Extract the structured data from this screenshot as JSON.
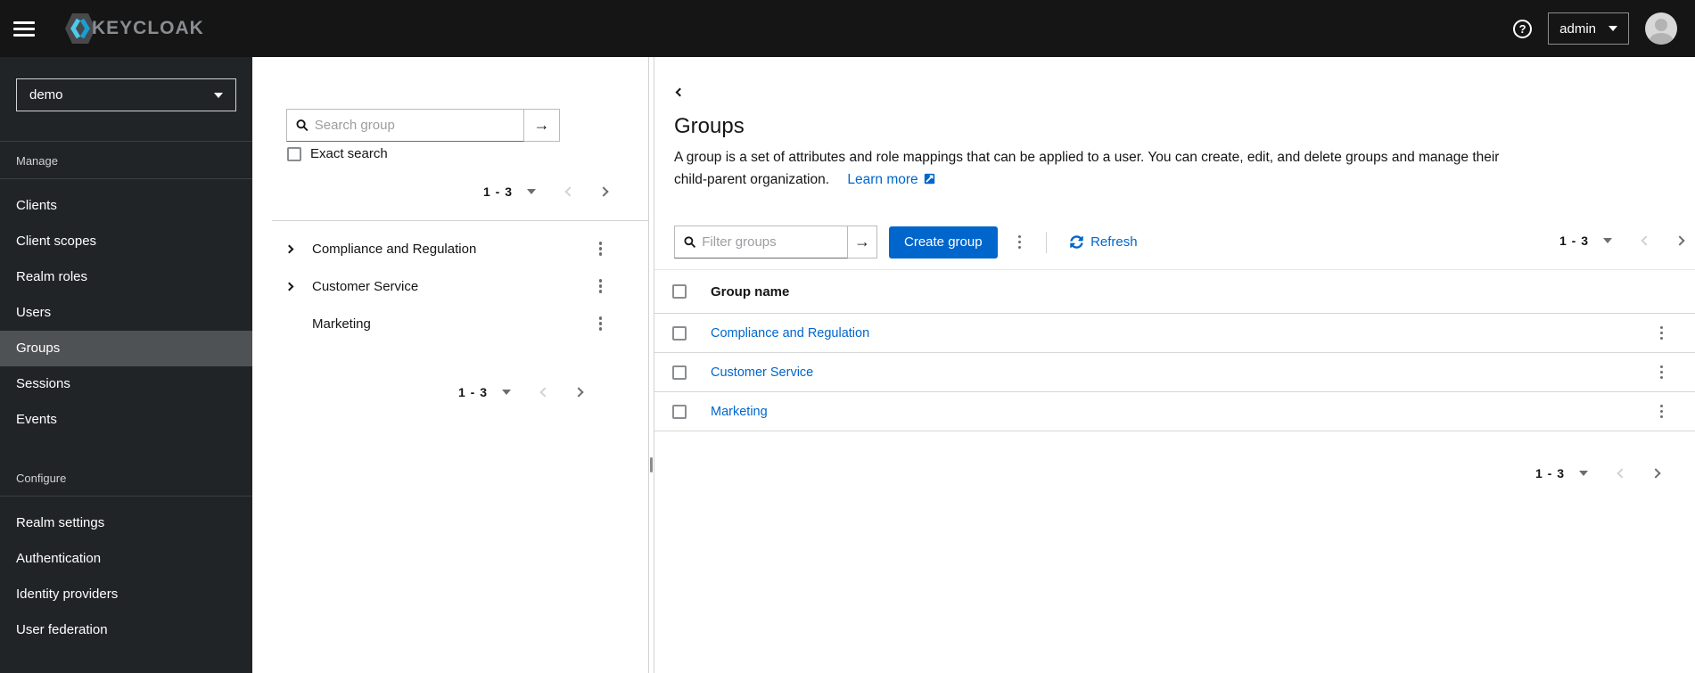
{
  "masthead": {
    "brand": "KEYCLOAK",
    "user": "admin",
    "help_glyph": "?"
  },
  "sidebar": {
    "realm": "demo",
    "manage": {
      "title": "Manage",
      "items": [
        "Clients",
        "Client scopes",
        "Realm roles",
        "Users",
        "Groups",
        "Sessions",
        "Events"
      ]
    },
    "configure": {
      "title": "Configure",
      "items": [
        "Realm settings",
        "Authentication",
        "Identity providers",
        "User federation"
      ]
    },
    "selected_item": "Groups"
  },
  "tree_panel": {
    "search_placeholder": "Search group",
    "exact_search_label": "Exact search",
    "pagination_top_range": "1 - 3",
    "pagination_bottom_range": "1 - 3",
    "items": [
      {
        "name": "Compliance and Regulation",
        "expandable": true
      },
      {
        "name": "Customer Service",
        "expandable": true
      },
      {
        "name": "Marketing",
        "expandable": false
      }
    ]
  },
  "main": {
    "title": "Groups",
    "description_line1": "A group is a set of attributes and role mappings that can be applied to a user. You can create, edit, and delete groups and manage their",
    "description_line2": "child-parent organization.",
    "learn_more_label": "Learn more",
    "toolbar": {
      "filter_placeholder": "Filter groups",
      "create_label": "Create group",
      "refresh_label": "Refresh",
      "pagination_range": "1 - 3"
    },
    "table": {
      "column_header": "Group name",
      "rows": [
        {
          "name": "Compliance and Regulation"
        },
        {
          "name": "Customer Service"
        },
        {
          "name": "Marketing"
        }
      ]
    },
    "bottom_pagination_range": "1 - 3"
  },
  "icons": {
    "arrow_right": "→"
  },
  "colors": {
    "primary": "#0066cc",
    "link": "#0066cc",
    "masthead_bg": "#151515",
    "sidebar_bg": "#212427",
    "sidebar_selected_bg": "#4f5255",
    "border": "#d2d2d2"
  }
}
